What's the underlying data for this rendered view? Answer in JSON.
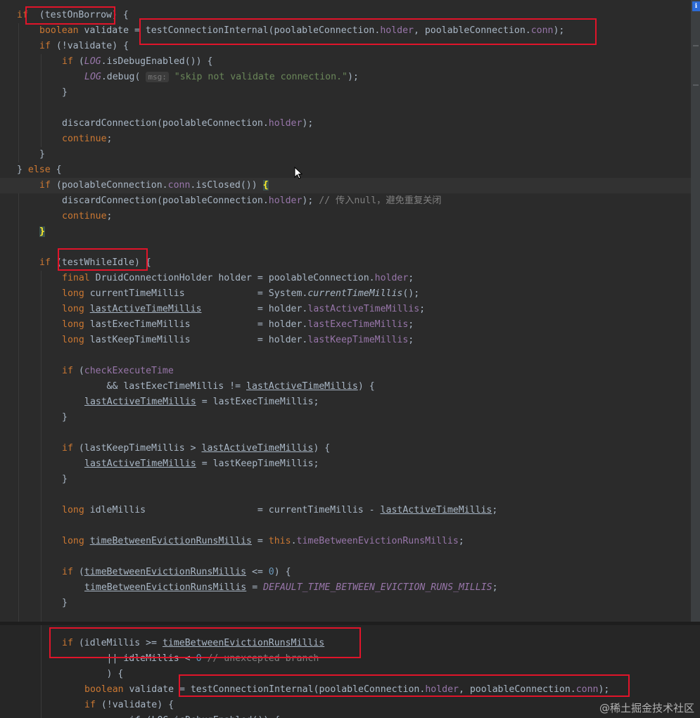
{
  "watermark": "@稀土掘金技术社区",
  "hint_label": "msg:",
  "lines": [
    {
      "parts": [
        [
          "kw",
          "if"
        ],
        [
          "",
          "  (testOnBorrow) {"
        ]
      ]
    },
    {
      "parts": [
        [
          "kw",
          "boolean"
        ],
        [
          "",
          " validate = testConnectionInternal(poolableConnection."
        ],
        [
          "fld",
          "holder"
        ],
        [
          "",
          ", poolableConnection."
        ],
        [
          "fld",
          "conn"
        ],
        [
          "",
          ");"
        ]
      ]
    },
    {
      "parts": [
        [
          "kw",
          "if"
        ],
        [
          "",
          " (!validate) {"
        ]
      ]
    },
    {
      "parts": [
        [
          "kw",
          "if"
        ],
        [
          "",
          " ("
        ],
        [
          "fldi",
          "LOG"
        ],
        [
          "",
          ".isDebugEnabled()) {"
        ]
      ]
    },
    {
      "parts": [
        [
          "fldi",
          "LOG"
        ],
        [
          "",
          ".debug( "
        ],
        [
          "hint",
          "msg:"
        ],
        [
          "str",
          " \"skip not validate connection.\""
        ],
        [
          "",
          ");"
        ]
      ]
    },
    {
      "parts": [
        [
          "",
          "}"
        ]
      ]
    },
    {
      "parts": []
    },
    {
      "parts": [
        [
          "",
          "discardConnection(poolableConnection."
        ],
        [
          "fld",
          "holder"
        ],
        [
          "",
          ");"
        ]
      ]
    },
    {
      "parts": [
        [
          "kw",
          "continue"
        ],
        [
          "",
          ";"
        ]
      ]
    },
    {
      "parts": [
        [
          "",
          "}"
        ]
      ]
    },
    {
      "parts": [
        [
          "",
          "} "
        ],
        [
          "kw",
          "else"
        ],
        [
          "",
          " {"
        ]
      ]
    },
    {
      "parts": [
        [
          "kw",
          "if"
        ],
        [
          "",
          " (poolableConnection."
        ],
        [
          "fld",
          "conn"
        ],
        [
          "",
          ".isClosed()) "
        ],
        [
          "brace",
          "{"
        ]
      ]
    },
    {
      "parts": [
        [
          "",
          "discardConnection(poolableConnection."
        ],
        [
          "fld",
          "holder"
        ],
        [
          "",
          "); "
        ],
        [
          "cmt",
          "// 传入null，避免重复关闭"
        ]
      ]
    },
    {
      "parts": [
        [
          "kw",
          "continue"
        ],
        [
          "",
          ";"
        ]
      ]
    },
    {
      "parts": [
        [
          "brace",
          "}"
        ]
      ]
    },
    {
      "parts": []
    },
    {
      "parts": [
        [
          "kw",
          "if"
        ],
        [
          "",
          " (testWhileIdle) {"
        ]
      ]
    },
    {
      "parts": [
        [
          "kw",
          "final"
        ],
        [
          "",
          " DruidConnectionHolder holder = poolableConnection."
        ],
        [
          "fld",
          "holder"
        ],
        [
          "",
          ";"
        ]
      ]
    },
    {
      "parts": [
        [
          "kw",
          "long"
        ],
        [
          "",
          " currentTimeMillis             = System."
        ],
        [
          "sti",
          "currentTimeMillis"
        ],
        [
          "",
          "();"
        ]
      ]
    },
    {
      "parts": [
        [
          "kw",
          "long"
        ],
        [
          "",
          " "
        ],
        [
          "ul",
          "lastActiveTimeMillis"
        ],
        [
          "",
          "          = holder."
        ],
        [
          "fld",
          "lastActiveTimeMillis"
        ],
        [
          "",
          ";"
        ]
      ]
    },
    {
      "parts": [
        [
          "kw",
          "long"
        ],
        [
          "",
          " lastExecTimeMillis            = holder."
        ],
        [
          "fld",
          "lastExecTimeMillis"
        ],
        [
          "",
          ";"
        ]
      ]
    },
    {
      "parts": [
        [
          "kw",
          "long"
        ],
        [
          "",
          " lastKeepTimeMillis            = holder."
        ],
        [
          "fld",
          "lastKeepTimeMillis"
        ],
        [
          "",
          ";"
        ]
      ]
    },
    {
      "parts": []
    },
    {
      "parts": [
        [
          "kw",
          "if"
        ],
        [
          "",
          " ("
        ],
        [
          "fld",
          "checkExecuteTime"
        ]
      ]
    },
    {
      "parts": [
        [
          "",
          "        && lastExecTimeMillis != "
        ],
        [
          "ul",
          "lastActiveTimeMillis"
        ],
        [
          "",
          ") {"
        ]
      ]
    },
    {
      "parts": [
        [
          "ul",
          "lastActiveTimeMillis"
        ],
        [
          "",
          " = lastExecTimeMillis;"
        ]
      ]
    },
    {
      "parts": [
        [
          "",
          "}"
        ]
      ]
    },
    {
      "parts": []
    },
    {
      "parts": [
        [
          "kw",
          "if"
        ],
        [
          "",
          " (lastKeepTimeMillis > "
        ],
        [
          "ul",
          "lastActiveTimeMillis"
        ],
        [
          "",
          ") {"
        ]
      ]
    },
    {
      "parts": [
        [
          "ul",
          "lastActiveTimeMillis"
        ],
        [
          "",
          " = lastKeepTimeMillis;"
        ]
      ]
    },
    {
      "parts": [
        [
          "",
          "}"
        ]
      ]
    },
    {
      "parts": []
    },
    {
      "parts": [
        [
          "kw",
          "long"
        ],
        [
          "",
          " idleMillis                    = currentTimeMillis - "
        ],
        [
          "ul",
          "lastActiveTimeMillis"
        ],
        [
          "",
          ";"
        ]
      ]
    },
    {
      "parts": []
    },
    {
      "parts": [
        [
          "kw",
          "long"
        ],
        [
          "",
          " "
        ],
        [
          "ul",
          "timeBetweenEvictionRunsMillis"
        ],
        [
          "",
          " = "
        ],
        [
          "kw",
          "this"
        ],
        [
          "",
          "."
        ],
        [
          "fld",
          "timeBetweenEvictionRunsMillis"
        ],
        [
          "",
          ";"
        ]
      ]
    },
    {
      "parts": []
    },
    {
      "parts": [
        [
          "kw",
          "if"
        ],
        [
          "",
          " ("
        ],
        [
          "ul",
          "timeBetweenEvictionRunsMillis"
        ],
        [
          "",
          " <= "
        ],
        [
          "num",
          "0"
        ],
        [
          "",
          ") {"
        ]
      ]
    },
    {
      "parts": [
        [
          "ul",
          "timeBetweenEvictionRunsMillis"
        ],
        [
          "",
          " = "
        ],
        [
          "fldi",
          "DEFAULT_TIME_BETWEEN_EVICTION_RUNS_MILLIS"
        ],
        [
          "",
          ";"
        ]
      ]
    },
    {
      "parts": [
        [
          "",
          "}"
        ]
      ]
    }
  ],
  "lines2": [
    {
      "parts": [
        [
          "kw",
          "if"
        ],
        [
          "",
          " (idleMillis >= "
        ],
        [
          "ul",
          "timeBetweenEvictionRunsMillis"
        ]
      ]
    },
    {
      "parts": [
        [
          "",
          "        || idleMillis < "
        ],
        [
          "num",
          "0"
        ],
        [
          "",
          " "
        ],
        [
          "cmt",
          "// unexcepted branch"
        ]
      ]
    },
    {
      "parts": [
        [
          "",
          "        ) {"
        ]
      ]
    },
    {
      "parts": [
        [
          "kw",
          "boolean"
        ],
        [
          "",
          " validate = testConnectionInternal(poolableConnection."
        ],
        [
          "fld",
          "holder"
        ],
        [
          "",
          ", poolableConnection."
        ],
        [
          "fld",
          "conn"
        ],
        [
          "",
          ");"
        ]
      ]
    },
    {
      "parts": [
        [
          "kw",
          "if"
        ],
        [
          "",
          " (!validate) {"
        ]
      ]
    },
    {
      "parts": [
        [
          "",
          "    if (LOG.isDebugEnabled()) {"
        ]
      ]
    }
  ]
}
